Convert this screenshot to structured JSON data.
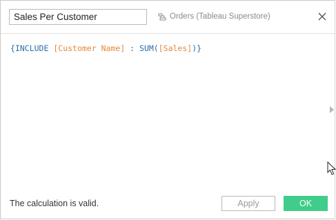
{
  "header": {
    "calc_name_value": "Sales Per Customer",
    "datasource_label": "Orders (Tableau Superstore)"
  },
  "editor": {
    "tokens": {
      "open_brace": "{",
      "keyword": "INCLUDE",
      "field1": "[Customer Name]",
      "colon": ":",
      "func": "SUM(",
      "field2": "[Sales]",
      "close": ")}"
    }
  },
  "footer": {
    "status_text": "The calculation is valid.",
    "apply_label": "Apply",
    "ok_label": "OK"
  },
  "colors": {
    "ok_button": "#40cc8a",
    "code_blue": "#2d6da5",
    "code_field": "#e2883d"
  },
  "icons": {
    "datasource": "datasource-icon",
    "close": "close-icon",
    "expand": "chevron-right-icon",
    "cursor": "mouse-pointer-icon"
  }
}
